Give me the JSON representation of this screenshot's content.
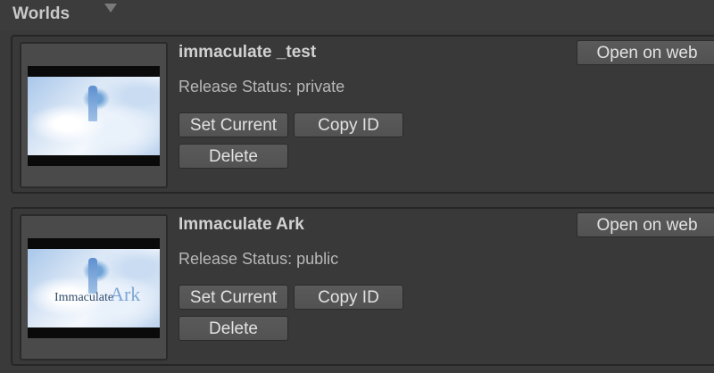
{
  "header": {
    "title": "Worlds",
    "foldout_icon": "triangle-down-icon"
  },
  "worlds": [
    {
      "name": "immaculate _test",
      "release_status": "Release Status: private",
      "thumbnail_overlay": "",
      "thumbnail_overlay_accent": "",
      "buttons": {
        "set_current": "Set Current",
        "copy_id": "Copy ID",
        "delete": "Delete",
        "open_on_web": "Open on web"
      }
    },
    {
      "name": "Immaculate Ark",
      "release_status": "Release Status: public",
      "thumbnail_overlay": "Immaculate",
      "thumbnail_overlay_accent": "Ark",
      "buttons": {
        "set_current": "Set Current",
        "copy_id": "Copy ID",
        "delete": "Delete",
        "open_on_web": "Open on web"
      }
    }
  ],
  "colors": {
    "background": "#3a3a3a",
    "card_border": "#262626",
    "button_bg": "#565656",
    "text_primary": "#d2d2d2",
    "text_secondary": "#b8b8b8"
  }
}
